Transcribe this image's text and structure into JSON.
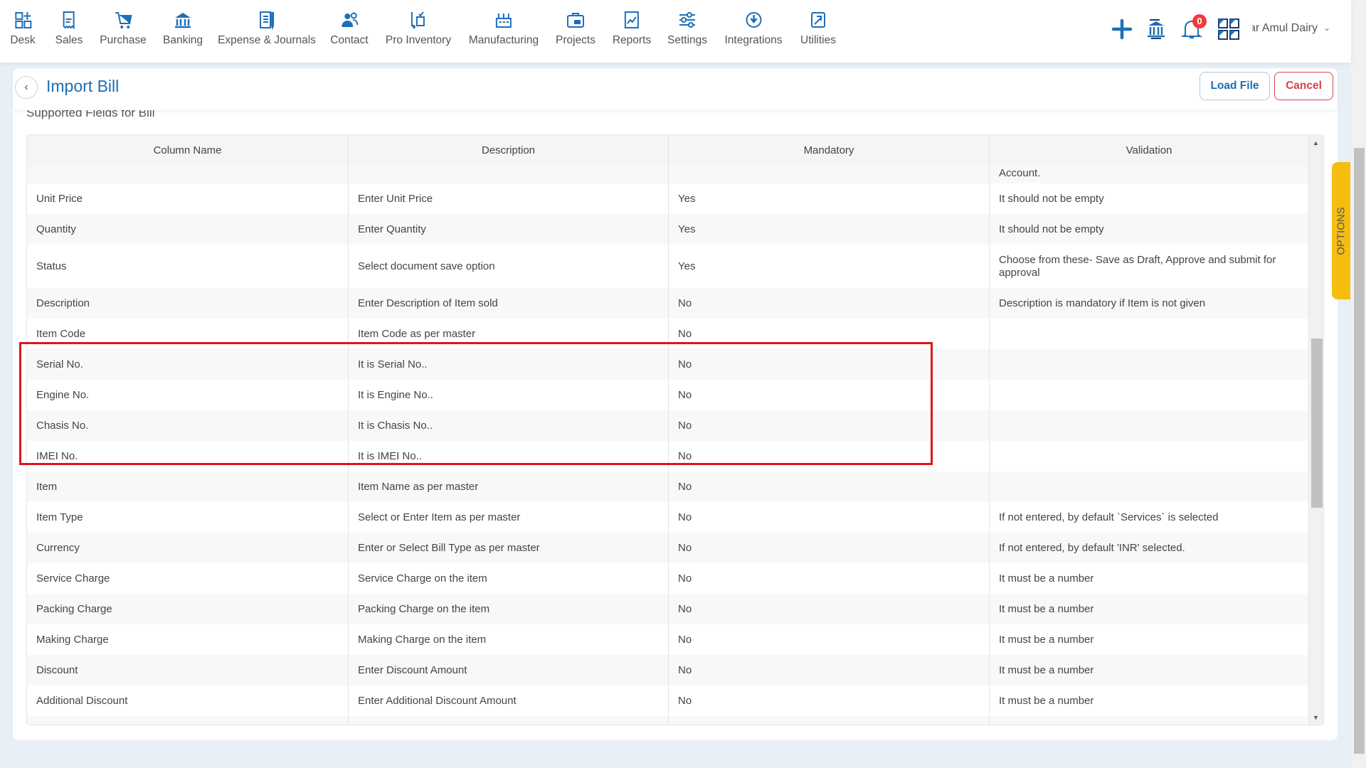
{
  "nav": {
    "items": [
      {
        "label": "Desk",
        "icon": "desk-grid-icon"
      },
      {
        "label": "Sales",
        "icon": "receipt-icon"
      },
      {
        "label": "Purchase",
        "icon": "cart-icon"
      },
      {
        "label": "Banking",
        "icon": "bank-icon"
      },
      {
        "label": "Expense & Journals",
        "icon": "notebook-icon"
      },
      {
        "label": "Contact",
        "icon": "contacts-icon"
      },
      {
        "label": "Pro Inventory",
        "icon": "inventory-icon"
      },
      {
        "label": "Manufacturing",
        "icon": "factory-icon"
      },
      {
        "label": "Projects",
        "icon": "projects-icon"
      },
      {
        "label": "Reports",
        "icon": "reports-icon"
      },
      {
        "label": "Settings",
        "icon": "sliders-icon"
      },
      {
        "label": "Integrations",
        "icon": "integrations-icon"
      },
      {
        "label": "Utilities",
        "icon": "utilities-icon"
      }
    ],
    "notification_count": "0",
    "user": "Kumar Amul Dairy",
    "accent": "#1a6fb5"
  },
  "header": {
    "title": "Import Bill",
    "load_file": "Load File",
    "cancel": "Cancel"
  },
  "section_title": "Supported Fields for Bill",
  "table": {
    "columns": [
      "Column Name",
      "Description",
      "Mandatory",
      "Validation"
    ],
    "partial_top": "Account.",
    "rows": [
      [
        "Unit Price",
        "Enter Unit Price",
        "Yes",
        "It should not be empty"
      ],
      [
        "Quantity",
        "Enter Quantity",
        "Yes",
        "It should not be empty"
      ],
      [
        "Status",
        "Select document save option",
        "Yes",
        "Choose from these- Save as Draft, Approve and submit for approval"
      ],
      [
        "Description",
        "Enter Description of Item sold",
        "No",
        "Description is mandatory if Item is not given"
      ],
      [
        "Item Code",
        "Item Code as per master",
        "No",
        ""
      ],
      [
        "Serial No.",
        "It is Serial No..",
        "No",
        ""
      ],
      [
        "Engine No.",
        "It is Engine No..",
        "No",
        ""
      ],
      [
        "Chasis No.",
        "It is Chasis No..",
        "No",
        ""
      ],
      [
        "IMEI No.",
        "It is IMEI No..",
        "No",
        ""
      ],
      [
        "Item",
        "Item Name as per master",
        "No",
        ""
      ],
      [
        "Item Type",
        "Select or Enter Item as per master",
        "No",
        "If not entered, by default `Services` is selected"
      ],
      [
        "Currency",
        "Enter or Select Bill Type as per master",
        "No",
        "If not entered, by default 'INR' selected."
      ],
      [
        "Service Charge",
        "Service Charge on the item",
        "No",
        "It must be a number"
      ],
      [
        "Packing Charge",
        "Packing Charge on the item",
        "No",
        "It must be a number"
      ],
      [
        "Making Charge",
        "Making Charge on the item",
        "No",
        "It must be a number"
      ],
      [
        "Discount",
        "Enter Discount Amount",
        "No",
        "It must be a number"
      ],
      [
        "Additional Discount",
        "Enter Additional Discount Amount",
        "No",
        "It must be a number"
      ]
    ],
    "highlight_color": "#e0141e"
  },
  "options_tab": "OPTIONS"
}
